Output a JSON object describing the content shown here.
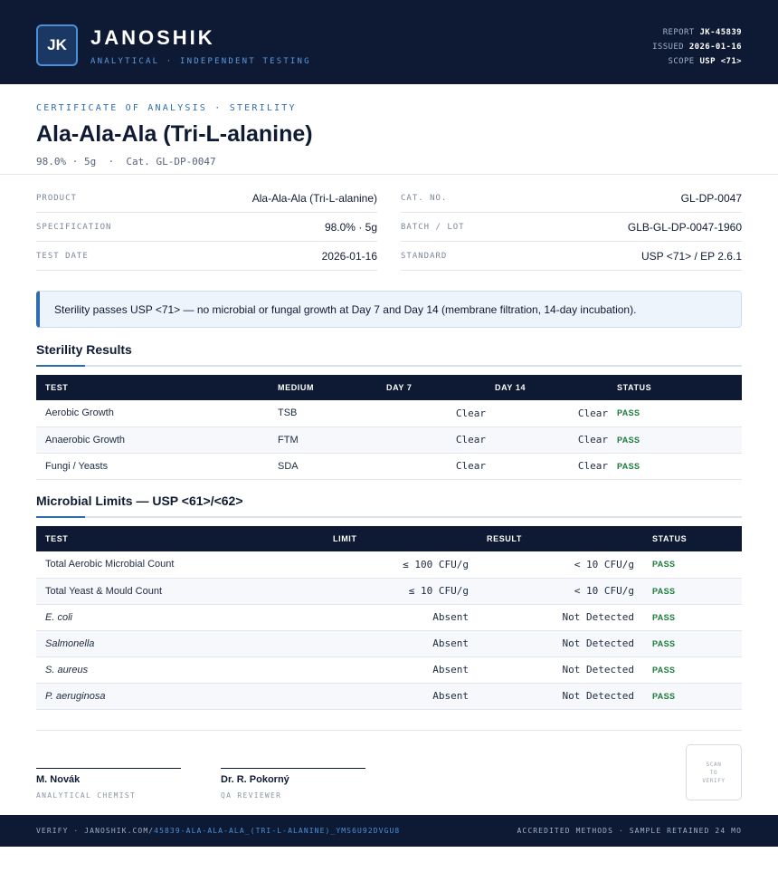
{
  "header": {
    "logo_initials": "JK",
    "brand": "JANOSHIK",
    "tagline": "ANALYTICAL · INDEPENDENT TESTING",
    "report_label": "REPORT",
    "report_value": "JK-45839",
    "issued_label": "ISSUED",
    "issued_value": "2026-01-16",
    "scope_label": "SCOPE",
    "scope_value": "USP <71>"
  },
  "title_block": {
    "kicker": "CERTIFICATE OF ANALYSIS · STERILITY",
    "title": "Ala-Ala-Ala (Tri-L-alanine)",
    "subtitle": "98.0% · 5g  ·  Cat. GL-DP-0047"
  },
  "info": {
    "left": [
      {
        "label": "PRODUCT",
        "value": "Ala-Ala-Ala (Tri-L-alanine)"
      },
      {
        "label": "SPECIFICATION",
        "value": "98.0% · 5g"
      },
      {
        "label": "TEST DATE",
        "value": "2026-01-16"
      }
    ],
    "right": [
      {
        "label": "CAT. NO.",
        "value": "GL-DP-0047"
      },
      {
        "label": "BATCH / LOT",
        "value": "GLB-GL-DP-0047-1960"
      },
      {
        "label": "STANDARD",
        "value": "USP <71> / EP 2.6.1"
      }
    ]
  },
  "notice": "Sterility passes USP <71> — no microbial or fungal growth at Day 7 and Day 14 (membrane filtration, 14-day incubation).",
  "sterility": {
    "title": "Sterility Results",
    "headers": [
      "TEST",
      "MEDIUM",
      "DAY 7",
      "DAY 14",
      "STATUS"
    ],
    "rows": [
      {
        "test": "Aerobic Growth",
        "medium": "TSB",
        "day7": "Clear",
        "day14": "Clear",
        "status": "PASS"
      },
      {
        "test": "Anaerobic Growth",
        "medium": "FTM",
        "day7": "Clear",
        "day14": "Clear",
        "status": "PASS"
      },
      {
        "test": "Fungi / Yeasts",
        "medium": "SDA",
        "day7": "Clear",
        "day14": "Clear",
        "status": "PASS"
      }
    ]
  },
  "microbial": {
    "title": "Microbial Limits — USP <61>/<62>",
    "headers": [
      "TEST",
      "LIMIT",
      "RESULT",
      "STATUS"
    ],
    "rows": [
      {
        "test": "Total Aerobic Microbial Count",
        "limit": "≤ 100 CFU/g",
        "result": "< 10 CFU/g",
        "status": "PASS"
      },
      {
        "test": "Total Yeast & Mould Count",
        "limit": "≤ 10 CFU/g",
        "result": "< 10 CFU/g",
        "status": "PASS"
      },
      {
        "test": "E. coli",
        "limit": "Absent",
        "result": "Not Detected",
        "status": "PASS"
      },
      {
        "test": "Salmonella",
        "limit": "Absent",
        "result": "Not Detected",
        "status": "PASS"
      },
      {
        "test": "S. aureus",
        "limit": "Absent",
        "result": "Not Detected",
        "status": "PASS"
      },
      {
        "test": "P. aeruginosa",
        "limit": "Absent",
        "result": "Not Detected",
        "status": "PASS"
      }
    ]
  },
  "signatures": [
    {
      "name": "M. Novák",
      "role": "ANALYTICAL CHEMIST"
    },
    {
      "name": "Dr. R. Pokorný",
      "role": "QA REVIEWER"
    }
  ],
  "qr": {
    "line1": "SCAN",
    "line2": "TO",
    "line3": "VERIFY"
  },
  "footer": {
    "verify_prefix": "VERIFY · JANOSHIK.COM/",
    "verify_link": "45839-ALA-ALA-ALA_(TRI-L-ALANINE)_YMS6U92DVGU8",
    "right": "ACCREDITED METHODS · SAMPLE RETAINED 24 MO"
  }
}
